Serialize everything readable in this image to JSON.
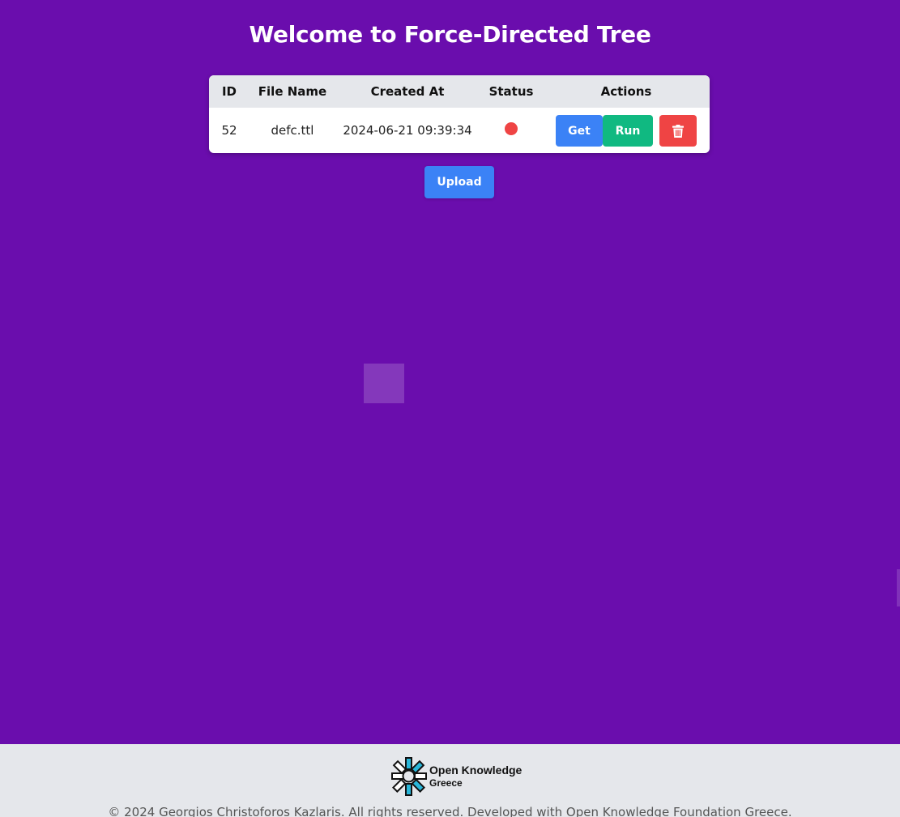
{
  "page": {
    "title": "Welcome to Force-Directed Tree"
  },
  "table": {
    "headers": {
      "id": "ID",
      "file_name": "File Name",
      "created_at": "Created At",
      "status": "Status",
      "actions": "Actions"
    },
    "rows": [
      {
        "id": "52",
        "file_name": "defc.ttl",
        "created_at": "2024-06-21 09:39:34",
        "status_color": "#ef4444",
        "actions": {
          "get_label": "Get",
          "run_label": "Run",
          "delete_icon": "trash-icon"
        }
      }
    ]
  },
  "upload": {
    "label": "Upload"
  },
  "footer": {
    "logo_line1": "Open Knowledge",
    "logo_line2": "Greece",
    "copyright": "© 2024 Georgios Christoforos Kazlaris. All rights reserved. Developed with Open Knowledge Foundation Greece."
  },
  "colors": {
    "background": "#6a0dad",
    "primary": "#3b82f6",
    "success": "#10b981",
    "danger": "#ef4444",
    "footer_bg": "#e5e7eb",
    "logo_accent": "#29b6d9"
  }
}
